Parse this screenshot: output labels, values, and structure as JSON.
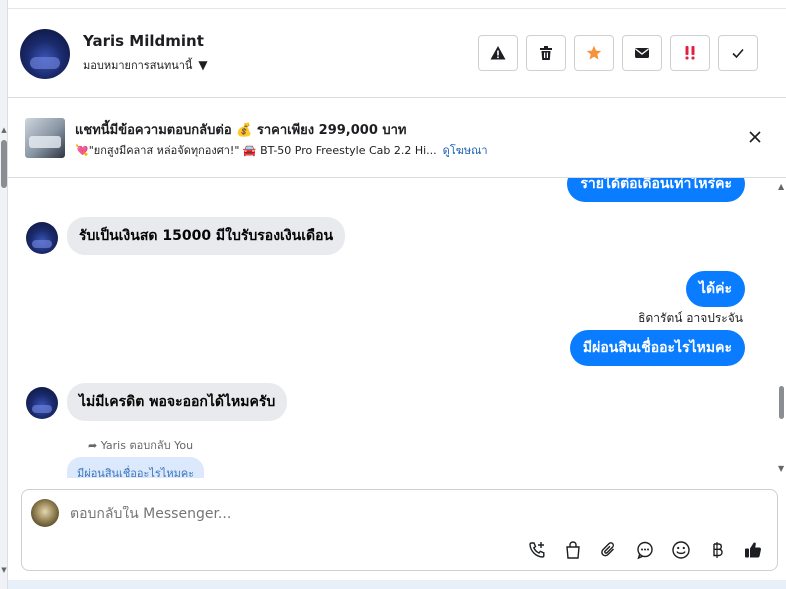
{
  "header": {
    "name": "Yaris Mildmint",
    "assign_label": "มอบหมายการสนทนานี้"
  },
  "actions": [
    {
      "id": "warning",
      "icon": "warning-icon"
    },
    {
      "id": "delete",
      "icon": "trash-icon"
    },
    {
      "id": "star",
      "icon": "star-icon",
      "color": "#f7923a"
    },
    {
      "id": "mail",
      "icon": "mail-icon"
    },
    {
      "id": "urgent",
      "icon": "double-exclamation-icon",
      "color": "#e41e3f"
    },
    {
      "id": "done",
      "icon": "check-icon"
    }
  ],
  "ad": {
    "title": "แชทนี้มีข้อความตอบกลับต่อ 💰 ราคาเพียง 299,000 บาท",
    "subtitle": "💘\"ยกสูงมีคลาส หล่อจัดทุกองศา!\" 🚘 BT-50 Pro Freestyle Cab 2.2 Hi...",
    "link": "ดูโฆษณา"
  },
  "messages": {
    "out_1": "รายได้ต่อเดือนเท่าไหร่คะ",
    "in_1": "รับเป็นเงินสด 15000 มีใบรับรองเงินเดือน",
    "out_2": "ได้ค่ะ",
    "sender_2": "ธิดารัตน์ อาจประจัน",
    "out_3": "มีผ่อนสินเชื่ออะไรไหมคะ",
    "in_2": "ไม่มีเครดิต พอจะออกได้ไหมครับ",
    "reply_note": "Yaris ตอบกลับ You",
    "quoted": "มีผ่อนสินเชื่ออะไรไหมคะ"
  },
  "composer": {
    "placeholder": "ตอบกลับใน Messenger..."
  },
  "tools": [
    "phone-plus-icon",
    "shopping-bag-icon",
    "paperclip-icon",
    "chat-bubble-icon",
    "smiley-icon",
    "baht-icon",
    "thumbs-up-icon"
  ],
  "colors": {
    "accent": "#0a7cff",
    "incoming_bubble": "#e9eaed",
    "link": "#1a5fb4"
  }
}
